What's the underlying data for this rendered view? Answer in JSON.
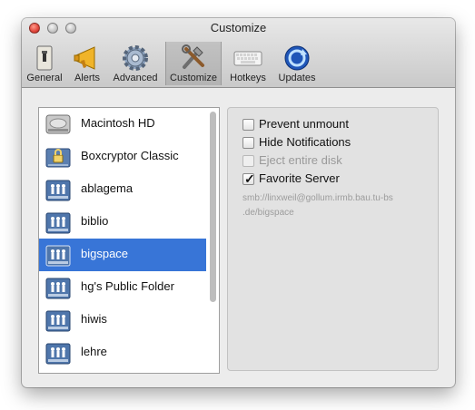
{
  "window": {
    "title": "Customize"
  },
  "toolbar": {
    "items": [
      {
        "label": "General",
        "icon": "general-icon"
      },
      {
        "label": "Alerts",
        "icon": "alerts-icon"
      },
      {
        "label": "Advanced",
        "icon": "advanced-icon"
      },
      {
        "label": "Customize",
        "icon": "customize-icon",
        "selected": true
      },
      {
        "label": "Hotkeys",
        "icon": "hotkeys-icon"
      },
      {
        "label": "Updates",
        "icon": "updates-icon"
      }
    ]
  },
  "volumes": {
    "items": [
      {
        "label": "Macintosh HD",
        "icon": "hard-disk-icon"
      },
      {
        "label": "Boxcryptor Classic",
        "icon": "encrypted-volume-icon"
      },
      {
        "label": "ablagema",
        "icon": "network-share-icon"
      },
      {
        "label": "biblio",
        "icon": "network-share-icon"
      },
      {
        "label": "bigspace",
        "icon": "network-share-icon",
        "selected": true
      },
      {
        "label": "hg's Public Folder",
        "icon": "network-share-icon"
      },
      {
        "label": "hiwis",
        "icon": "network-share-icon"
      },
      {
        "label": "lehre",
        "icon": "network-share-icon"
      }
    ]
  },
  "options": {
    "prevent_unmount": {
      "label": "Prevent unmount",
      "checked": false
    },
    "hide_notifications": {
      "label": "Hide Notifications",
      "checked": false
    },
    "eject_entire_disk": {
      "label": "Eject entire disk",
      "checked": false,
      "disabled": true
    },
    "favorite_server": {
      "label": "Favorite Server",
      "checked": true
    }
  },
  "server_url": {
    "line1": "smb://linxweil@gollum.irmb.bau.tu-bs",
    "line2": ".de/bigspace"
  },
  "colors": {
    "selection": "#3875d7",
    "window_bg": "#ececec"
  }
}
